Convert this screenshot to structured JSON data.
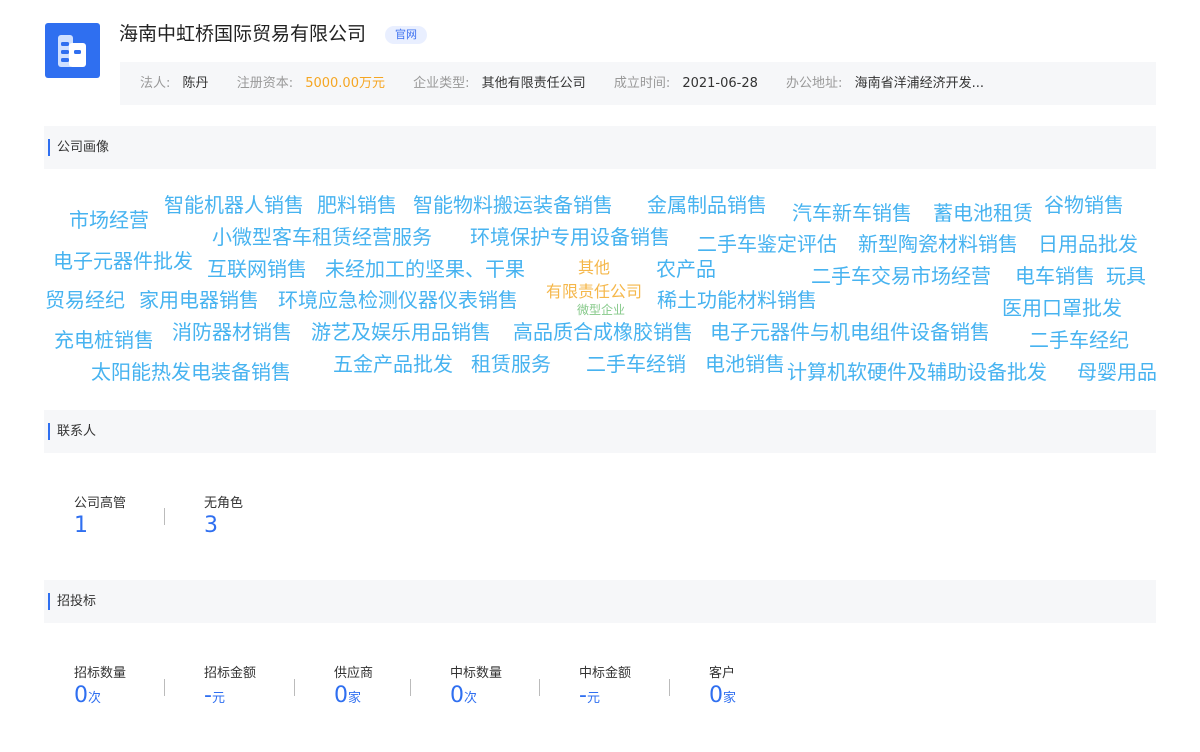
{
  "company": {
    "name": "海南中虹桥国际贸易有限公司",
    "badge": "官网",
    "info": [
      {
        "label": "法人:",
        "value": "陈丹"
      },
      {
        "label": "注册资本:",
        "value": "5000.00万元"
      },
      {
        "label": "企业类型:",
        "value": "其他有限责任公司"
      },
      {
        "label": "成立时间:",
        "value": "2021-06-28"
      },
      {
        "label": "办公地址:",
        "value": "海南省洋浦经济开发..."
      }
    ]
  },
  "sections": {
    "portrait": "公司画像",
    "contacts": "联系人",
    "bidding": "招投标"
  },
  "word_cloud": [
    "市场经营",
    "智能机器人销售",
    "肥料销售",
    "智能物料搬运装备销售",
    "金属制品销售",
    "汽车新车销售",
    "蓄电池租赁",
    "谷物销售",
    "小微型客车租赁经营服务",
    "环境保护专用设备销售",
    "二手车鉴定评估",
    "新型陶瓷材料销售",
    "日用品批发",
    "电子元器件批发",
    "互联网销售",
    "未经加工的坚果、干果",
    "其他",
    "农产品",
    "二手车交易市场经营",
    "电车销售",
    "玩具",
    "贸易经纪",
    "家用电器销售",
    "环境应急检测仪器仪表销售",
    "有限责任公司",
    "稀土功能材料销售",
    "微型企业",
    "医用口罩批发",
    "充电桩销售",
    "消防器材销售",
    "游艺及娱乐用品销售",
    "高品质合成橡胶销售",
    "电子元器件与机电组件设备销售",
    "二手车经纪",
    "太阳能热发电装备销售",
    "五金产品批发",
    "租赁服务",
    "二手车经销",
    "电池销售",
    "计算机软硬件及辅助设备批发",
    "母婴用品"
  ],
  "contacts": [
    {
      "label": "公司高管",
      "value": "1"
    },
    {
      "label": "无角色",
      "value": "3"
    }
  ],
  "bidding": [
    {
      "label": "招标数量",
      "value": "0",
      "unit": "次"
    },
    {
      "label": "招标金额",
      "value": "-",
      "unit": "元"
    },
    {
      "label": "供应商",
      "value": "0",
      "unit": "家"
    },
    {
      "label": "中标数量",
      "value": "0",
      "unit": "次"
    },
    {
      "label": "中标金额",
      "value": "-",
      "unit": "元"
    },
    {
      "label": "客户",
      "value": "0",
      "unit": "家"
    }
  ],
  "colors": {
    "accent": "#2f6ff0",
    "cloud": "#47b3f0",
    "gold": "#f5b74a",
    "green": "#86c98a",
    "money": "#f5a623"
  }
}
